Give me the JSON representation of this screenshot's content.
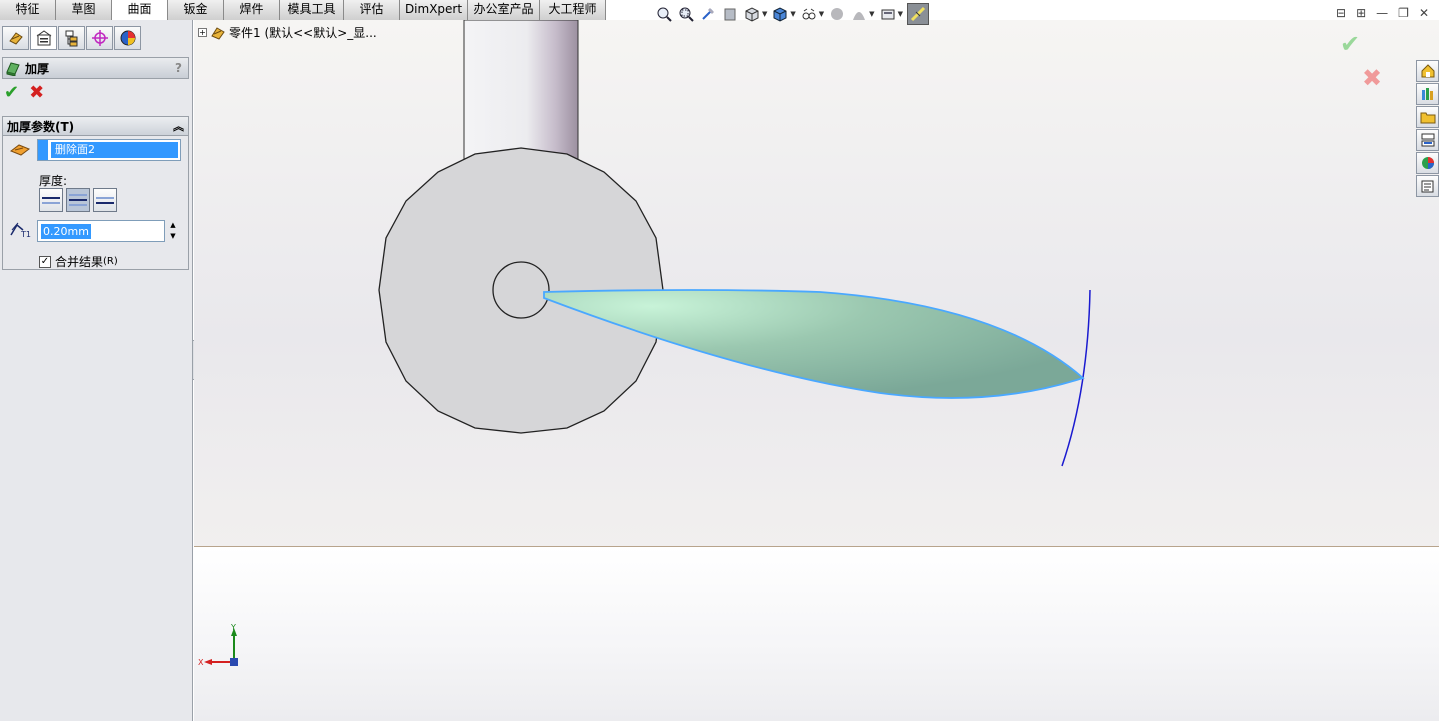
{
  "tabs": [
    {
      "label": "特征"
    },
    {
      "label": "草图"
    },
    {
      "label": "曲面",
      "active": true
    },
    {
      "label": "钣金"
    },
    {
      "label": "焊件"
    },
    {
      "label": "模具工具"
    },
    {
      "label": "评估"
    },
    {
      "label": "DimXpert"
    },
    {
      "label": "办公室产品"
    },
    {
      "label": "大工程师"
    }
  ],
  "property_manager": {
    "title": "加厚",
    "help": "?",
    "ok": "✔",
    "cancel": "✖",
    "group_title": "加厚参数(T)",
    "collapse": "︽",
    "face_value": "删除面2",
    "thickness_label": "厚度:",
    "t1_value": "0.20mm",
    "t1_label": "T1",
    "merge_label": "合并结果",
    "merge_shortcut": "(R)",
    "merge_checked": "✓"
  },
  "tree": {
    "expander": "+",
    "root_label": "零件1  (默认<<默认>_显..."
  },
  "triad": {
    "x_label": "X",
    "y_label": "Y"
  },
  "window_controls": [
    "⊟",
    "⊞",
    "—",
    "❐",
    "✕"
  ],
  "confirm_corner": {
    "ok": "✔",
    "cancel": "✖"
  },
  "colors": {
    "accent": "#3399ff",
    "ok_green": "#2ba02b",
    "cancel_red": "#d42020",
    "blade_fill": "#8fbfa8",
    "blade_edge": "#4aa8ff",
    "sketch_arc": "#1a1ad0"
  }
}
